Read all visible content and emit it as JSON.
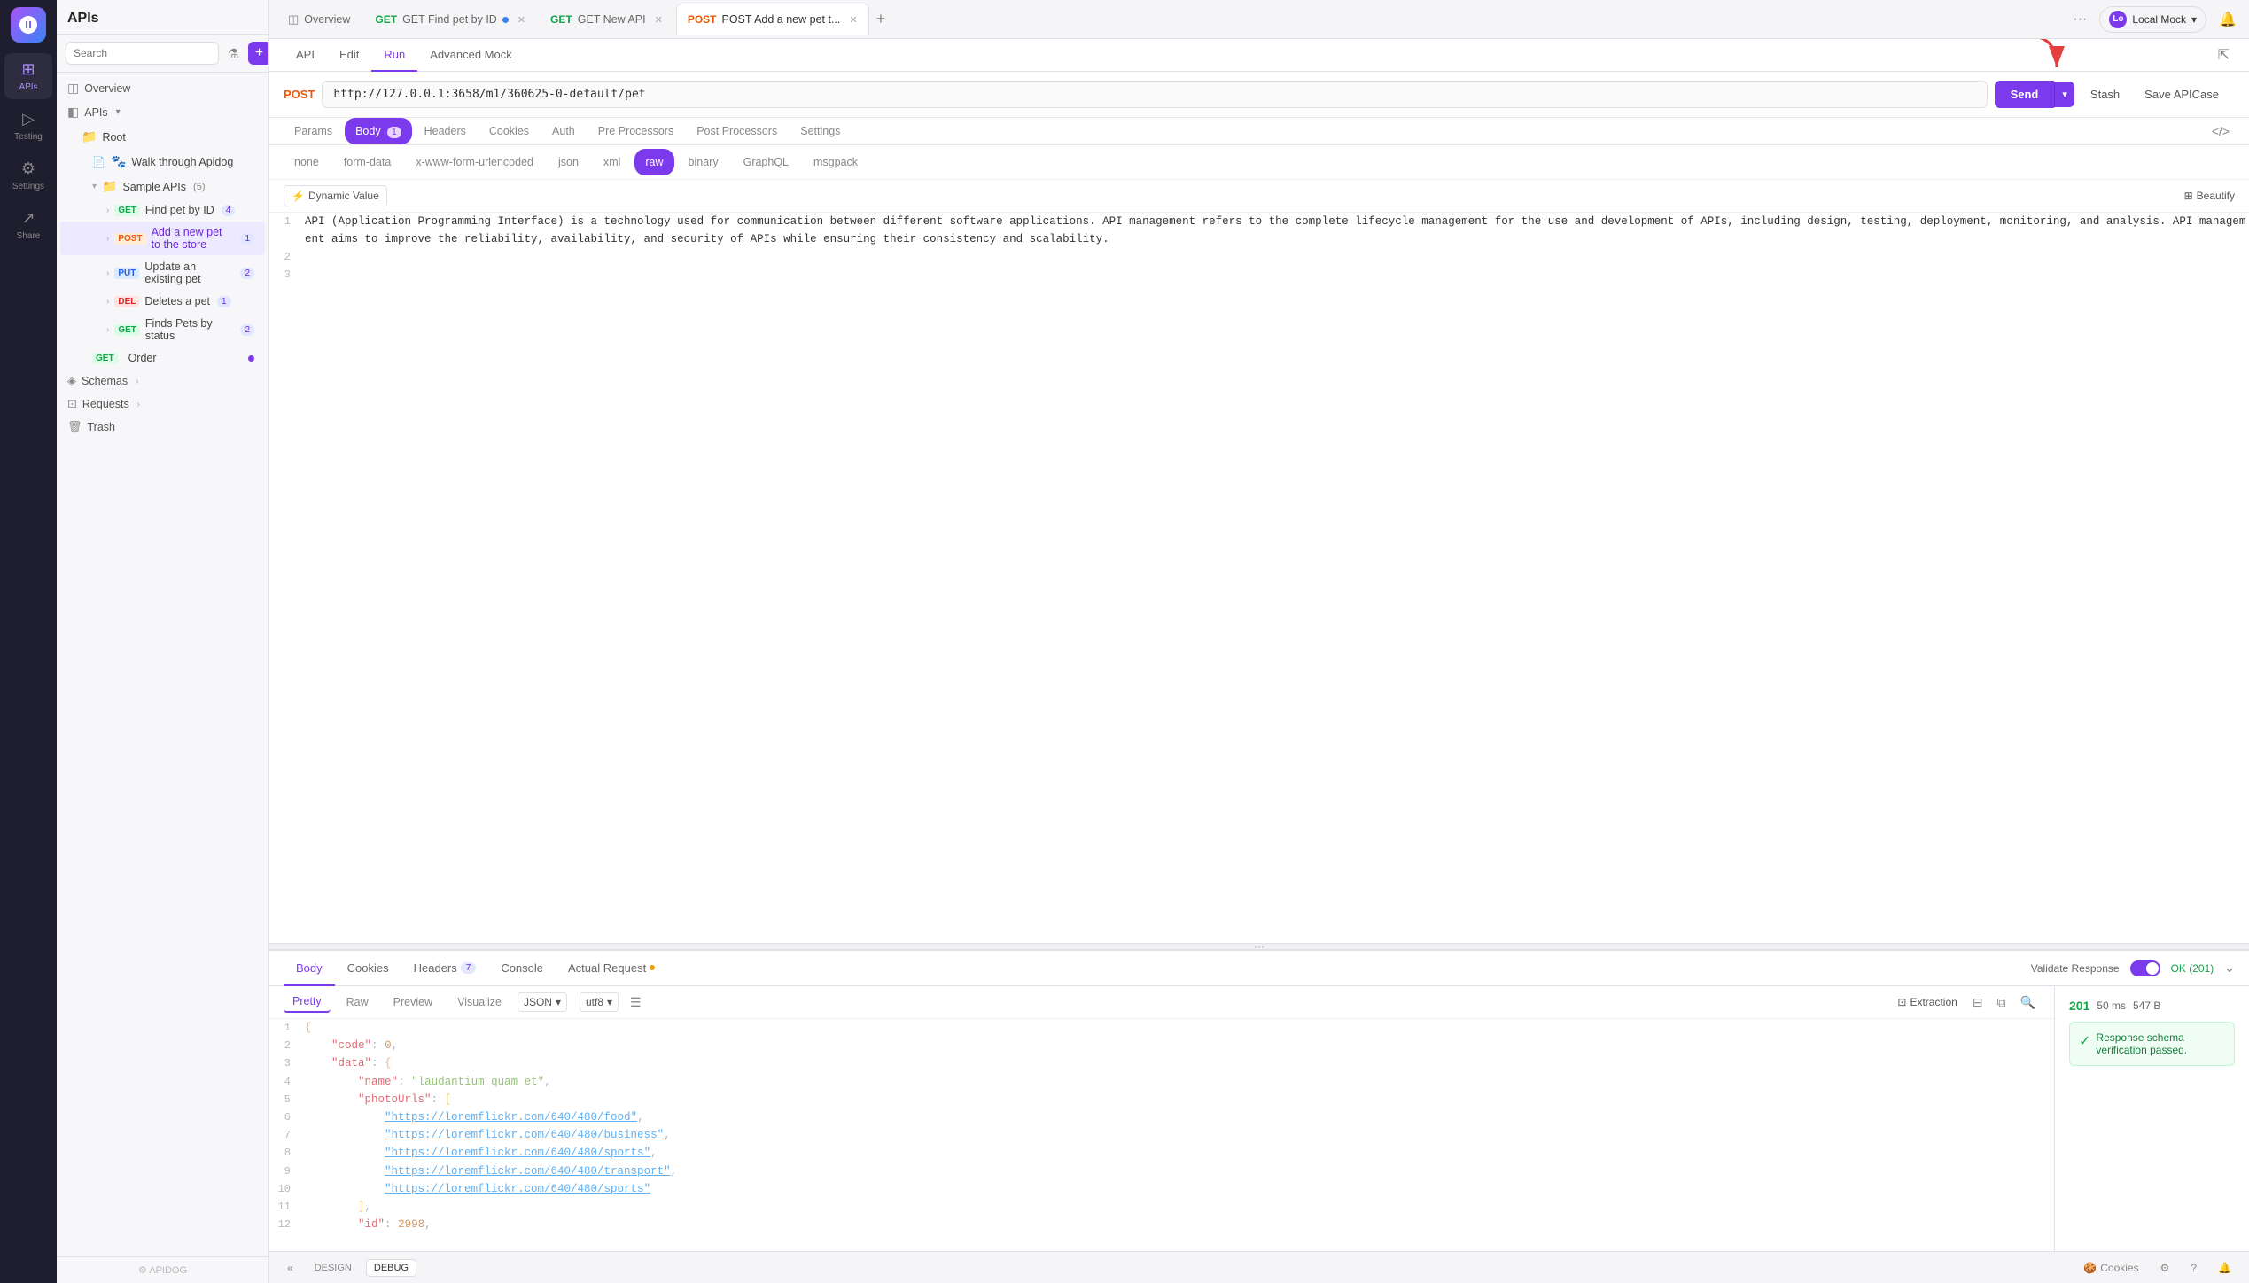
{
  "app": {
    "title": "APIs",
    "logo_text": "A"
  },
  "sidebar": {
    "nav_items": [
      {
        "id": "apis",
        "label": "APIs",
        "icon": "⊞",
        "active": true
      },
      {
        "id": "testing",
        "label": "Testing",
        "icon": "▷"
      },
      {
        "id": "settings",
        "label": "Settings",
        "icon": "⚙"
      },
      {
        "id": "share",
        "label": "Share",
        "icon": "↗"
      }
    ]
  },
  "nav_panel": {
    "title": "APIs",
    "search_placeholder": "Search",
    "overview_label": "Overview",
    "apis_label": "APIs",
    "root_label": "Root",
    "walkthroughLabel": "Walk through Apidog",
    "sample_apis_label": "Sample APIs",
    "sample_apis_count": "(5)",
    "tree_items": [
      {
        "method": "GET",
        "label": "Find pet by ID",
        "count": "(4)",
        "indent": 2
      },
      {
        "method": "POST",
        "label": "Add a new pet to the store",
        "count": "(1)",
        "indent": 2,
        "active": true
      },
      {
        "method": "PUT",
        "label": "Update an existing pet",
        "count": "(2)",
        "indent": 2
      },
      {
        "method": "DEL",
        "label": "Deletes a pet",
        "count": "(1)",
        "indent": 2
      },
      {
        "method": "GET",
        "label": "Finds Pets by status",
        "count": "(2)",
        "indent": 2
      }
    ],
    "order_label": "Order",
    "schemas_label": "Schemas",
    "requests_label": "Requests",
    "trash_label": "Trash",
    "footer_label": "APIDOG"
  },
  "tabs": [
    {
      "id": "overview",
      "label": "Overview",
      "type": "overview"
    },
    {
      "id": "get-find-pet",
      "label": "GET Find pet by ID",
      "type": "get",
      "active": false,
      "has_dot": true
    },
    {
      "id": "get-new-api",
      "label": "GET New API",
      "type": "get",
      "active": false
    },
    {
      "id": "post-add-pet",
      "label": "POST Add a new pet t...",
      "type": "post",
      "active": true
    }
  ],
  "sub_tabs": [
    {
      "id": "api",
      "label": "API"
    },
    {
      "id": "edit",
      "label": "Edit"
    },
    {
      "id": "run",
      "label": "Run",
      "active": true
    },
    {
      "id": "advanced-mock",
      "label": "Advanced Mock"
    }
  ],
  "request": {
    "method": "POST",
    "url": "http://127.0.0.1:3658/m1/360625-0-default/pet",
    "send_label": "Send",
    "stash_label": "Stash",
    "save_label": "Save APICase"
  },
  "body_tabs": [
    {
      "id": "params",
      "label": "Params"
    },
    {
      "id": "body",
      "label": "Body",
      "count": "1",
      "active": true
    },
    {
      "id": "headers",
      "label": "Headers"
    },
    {
      "id": "cookies",
      "label": "Cookies"
    },
    {
      "id": "auth",
      "label": "Auth"
    },
    {
      "id": "pre-processors",
      "label": "Pre Processors"
    },
    {
      "id": "post-processors",
      "label": "Post Processors"
    },
    {
      "id": "settings",
      "label": "Settings"
    }
  ],
  "body_types": [
    {
      "id": "none",
      "label": "none"
    },
    {
      "id": "form-data",
      "label": "form-data"
    },
    {
      "id": "x-www-form-urlencoded",
      "label": "x-www-form-urlencoded"
    },
    {
      "id": "json",
      "label": "json"
    },
    {
      "id": "xml",
      "label": "xml"
    },
    {
      "id": "raw",
      "label": "raw",
      "active": true
    },
    {
      "id": "binary",
      "label": "binary"
    },
    {
      "id": "graphql",
      "label": "GraphQL"
    },
    {
      "id": "msgpack",
      "label": "msgpack"
    }
  ],
  "dynamic_value_label": "Dynamic Value",
  "beautify_label": "Beautify",
  "request_body": "API (Application Programming Interface) is a technology used for communication between different software applications. API management refers to the complete lifecycle management for the use and development of APIs, including design, testing, deployment, monitoring, and analysis. API management aims to improve the reliability, availability, and security of APIs while ensuring their consistency and scalability.",
  "response": {
    "tabs": [
      {
        "id": "body",
        "label": "Body",
        "active": true
      },
      {
        "id": "cookies",
        "label": "Cookies"
      },
      {
        "id": "headers",
        "label": "Headers",
        "count": "7"
      },
      {
        "id": "console",
        "label": "Console"
      },
      {
        "id": "actual-request",
        "label": "Actual Request",
        "has_dot": true
      }
    ],
    "validate_label": "Validate Response",
    "ok_label": "OK (201)",
    "status": "201",
    "time": "50 ms",
    "size": "547 B",
    "schema_verify": "Response schema verification passed.",
    "format_tabs": [
      {
        "id": "pretty",
        "label": "Pretty",
        "active": true
      },
      {
        "id": "raw",
        "label": "Raw"
      },
      {
        "id": "preview",
        "label": "Preview"
      },
      {
        "id": "visualize",
        "label": "Visualize"
      }
    ],
    "format_select": "JSON",
    "encoding_select": "utf8",
    "extraction_label": "Extraction",
    "body_lines": [
      {
        "num": 1,
        "content": "{"
      },
      {
        "num": 2,
        "content": "    \"code\": 0,"
      },
      {
        "num": 3,
        "content": "    \"data\": {"
      },
      {
        "num": 4,
        "content": "        \"name\": \"laudantium quam et\","
      },
      {
        "num": 5,
        "content": "        \"photoUrls\": ["
      },
      {
        "num": 6,
        "content": "            \"https://loremflickr.com/640/480/food\","
      },
      {
        "num": 7,
        "content": "            \"https://loremflickr.com/640/480/business\","
      },
      {
        "num": 8,
        "content": "            \"https://loremflickr.com/640/480/sports\","
      },
      {
        "num": 9,
        "content": "            \"https://loremflickr.com/640/480/transport\","
      },
      {
        "num": 10,
        "content": "            \"https://loremflickr.com/640/480/sports\""
      },
      {
        "num": 11,
        "content": "        ],"
      },
      {
        "num": 12,
        "content": "        \"id\": 2998,"
      }
    ]
  },
  "bottom_bar": {
    "collapse_icon": "«",
    "design_label": "DESIGN",
    "debug_label": "DEBUG",
    "cookies_label": "Cookies",
    "settings_icon": "⚙",
    "help_icon": "?",
    "bell_icon": "🔔"
  },
  "mock": {
    "avatar": "Lo",
    "label": "Local Mock",
    "dropdown": "▾"
  }
}
